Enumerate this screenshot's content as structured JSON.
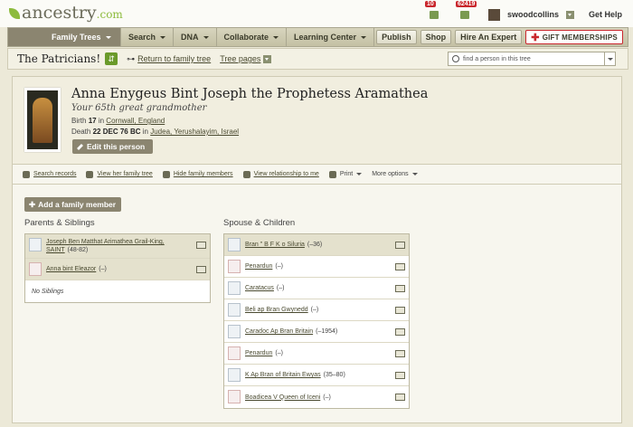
{
  "header": {
    "logo": "ancestry",
    "logo_suffix": ".com",
    "notifications": [
      {
        "count": "10",
        "icon": "leaf-hint-icon"
      },
      {
        "count": "62419",
        "icon": "message-icon"
      }
    ],
    "username": "swoodcollins",
    "help": "Get Help"
  },
  "nav": {
    "items": [
      {
        "label": "Family Trees",
        "active": true
      },
      {
        "label": "Search"
      },
      {
        "label": "DNA"
      },
      {
        "label": "Collaborate"
      },
      {
        "label": "Learning Center"
      }
    ],
    "buttons": [
      "Publish",
      "Shop",
      "Hire An Expert"
    ],
    "gift": "GIFT MEMBERSHIPS"
  },
  "treebar": {
    "tree_name": "The Patricians!",
    "return_link": "Return to family tree",
    "tree_pages": "Tree pages",
    "search_placeholder": "find a person in this tree"
  },
  "person": {
    "name": "Anna Enygeus Bint Joseph the Prophetess Aramathea",
    "relationship": "Your 65th great grandmother",
    "birth_label": "Birth",
    "birth_date": "17",
    "birth_in": "in",
    "birth_place": "Cornwall, England",
    "death_label": "Death",
    "death_date": "22 DEC 76 BC",
    "death_in": "in",
    "death_place": "Judea, Yerushalayim, Israel",
    "edit_button": "Edit this person"
  },
  "actions": [
    {
      "label": "Search records",
      "icon": "search-icon",
      "link": true
    },
    {
      "label": "View her family tree",
      "icon": "tree-icon",
      "link": true
    },
    {
      "label": "Hide family members",
      "icon": "hide-icon",
      "link": true
    },
    {
      "label": "View relationship to me",
      "icon": "relationship-icon",
      "link": true
    },
    {
      "label": "Print",
      "icon": "print-icon",
      "link": false
    },
    {
      "label": "More options",
      "icon": "",
      "link": false
    }
  ],
  "add_family": "Add a family member",
  "parents": {
    "title": "Parents & Siblings",
    "rows": [
      {
        "name": "Joseph Ben Matthat Arimathea Grail-King, SAINT",
        "dates": "(48-82)",
        "gender": "m"
      },
      {
        "name": "Anna bint Eleazor",
        "dates": "(–)",
        "gender": "f"
      }
    ],
    "no_siblings": "No Siblings"
  },
  "spouse": {
    "title": "Spouse & Children",
    "rows": [
      {
        "name": "Bran \" B F K o Siluria",
        "dates": "(–36)",
        "gender": "m"
      },
      {
        "name": "Penardun",
        "dates": "(–)",
        "gender": "f"
      },
      {
        "name": "Caratacus",
        "dates": "(–)",
        "gender": "m"
      },
      {
        "name": "Beli ap Bran Gwynedd",
        "dates": "(–)",
        "gender": "m"
      },
      {
        "name": "Caradoc Ap Bran Britain",
        "dates": "(–1954)",
        "gender": "m"
      },
      {
        "name": "Penardun",
        "dates": "(–)",
        "gender": "f"
      },
      {
        "name": "K Ap Bran of Britain Ewyas",
        "dates": "(35–80)",
        "gender": "m"
      },
      {
        "name": "Boadicea V Queen of Iceni",
        "dates": "(–)",
        "gender": "f"
      }
    ]
  },
  "colors": {
    "accent": "#8b8570",
    "brand_green": "#8dbb3d",
    "badge_red": "#c9272d"
  }
}
